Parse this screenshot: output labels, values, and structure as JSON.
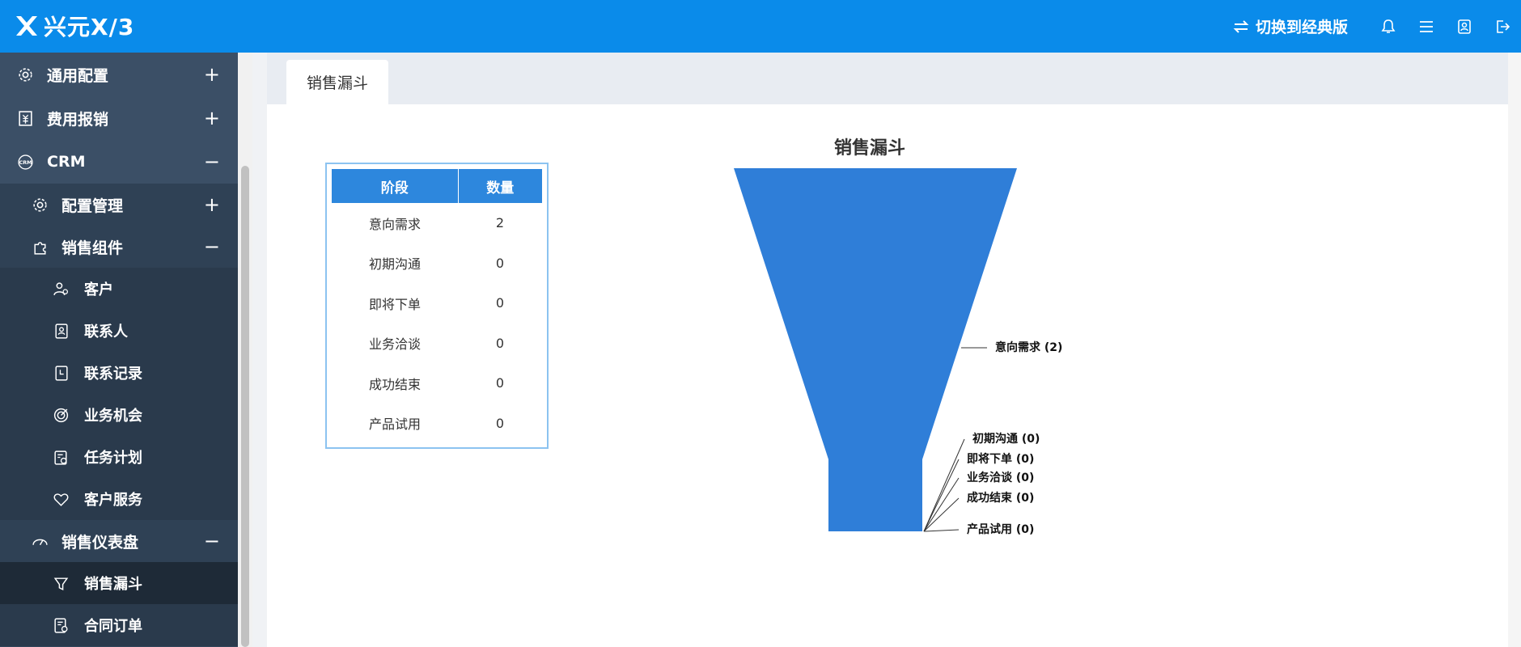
{
  "app": {
    "logo_text": "兴元X/3",
    "switch_label": "切换到经典版",
    "accent_color": "#0a8bea",
    "top_icons": [
      "bell-icon",
      "menu-list-icon",
      "user-card-icon",
      "logout-icon"
    ]
  },
  "sidebar": {
    "items": [
      {
        "label": "通用配置",
        "icon": "gear-icon",
        "toggle": "+"
      },
      {
        "label": "费用报销",
        "icon": "receipt-icon",
        "toggle": "+"
      },
      {
        "label": "CRM",
        "icon": "crm-icon",
        "toggle": "−"
      },
      {
        "label": "配置管理",
        "icon": "gear-icon",
        "toggle": "+"
      },
      {
        "label": "销售组件",
        "icon": "puzzle-icon",
        "toggle": "−"
      },
      {
        "label": "客户",
        "icon": "customer-icon"
      },
      {
        "label": "联系人",
        "icon": "contact-card-icon"
      },
      {
        "label": "联系记录",
        "icon": "record-icon"
      },
      {
        "label": "业务机会",
        "icon": "target-icon"
      },
      {
        "label": "任务计划",
        "icon": "task-plan-icon"
      },
      {
        "label": "客户服务",
        "icon": "heart-icon"
      },
      {
        "label": "销售仪表盘",
        "icon": "dashboard-gauge-icon",
        "toggle": "−"
      },
      {
        "label": "销售漏斗",
        "icon": "funnel-icon"
      },
      {
        "label": "合同订单",
        "icon": "contract-icon"
      }
    ]
  },
  "tabs": [
    {
      "label": "销售漏斗"
    }
  ],
  "table": {
    "headers": [
      "阶段",
      "数量"
    ],
    "rows": [
      [
        "意向需求",
        "2"
      ],
      [
        "初期沟通",
        "0"
      ],
      [
        "即将下单",
        "0"
      ],
      [
        "业务洽谈",
        "0"
      ],
      [
        "成功结束",
        "0"
      ],
      [
        "产品试用",
        "0"
      ]
    ]
  },
  "chart_data": {
    "type": "funnel",
    "title": "销售漏斗",
    "color": "#2f7ed8",
    "categories": [
      "意向需求",
      "初期沟通",
      "即将下单",
      "业务洽谈",
      "成功结束",
      "产品试用"
    ],
    "values": [
      2,
      0,
      0,
      0,
      0,
      0
    ],
    "labels": [
      "意向需求 (2)",
      "初期沟通 (0)",
      "即将下单 (0)",
      "业务洽谈 (0)",
      "成功结束 (0)",
      "产品试用 (0)"
    ]
  }
}
